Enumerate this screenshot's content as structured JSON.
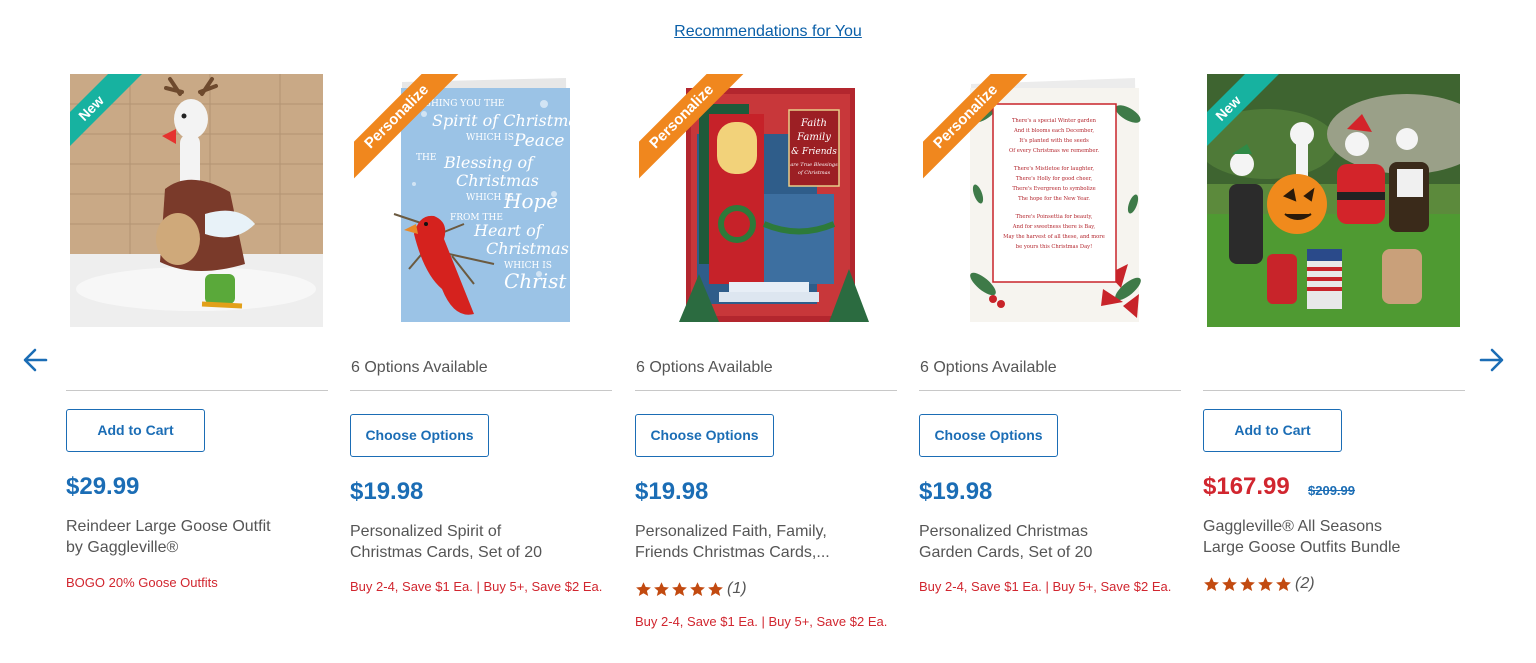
{
  "section": {
    "title": "Recommendations for You"
  },
  "nav": {
    "prev_icon": "arrow-left-icon",
    "next_icon": "arrow-right-icon"
  },
  "colors": {
    "link": "#1b6db5",
    "sale": "#d1262f",
    "new_badge": "#17b2a0",
    "personalize_badge": "#f0871e",
    "star": "#c24a10"
  },
  "products": [
    {
      "badge": "New",
      "options_text": "",
      "button_label": "Add to Cart",
      "price": "$29.99",
      "name": "Reindeer Large Goose Outfit by Gaggleville®",
      "promo": "BOGO 20% Goose Outfits"
    },
    {
      "badge": "Personalize",
      "options_text": "6 Options Available",
      "button_label": "Choose Options",
      "price": "$19.98",
      "name": "Personalized Spirit of Christmas Cards, Set of 20",
      "promo": "Buy 2-4, Save $1 Ea. | Buy 5+, Save $2 Ea.",
      "card_text": {
        "l1": "WISHING YOU THE",
        "l2": "Spirit of Christmas",
        "l3": "WHICH IS",
        "l4": "Peace",
        "l5": "THE",
        "l6": "Blessing of",
        "l7": "Christmas",
        "l8": "WHICH IS",
        "l9": "Hope",
        "l10": "FROM THE",
        "l11": "Heart of",
        "l12": "Christmas",
        "l13": "WHICH IS",
        "l14": "Christ"
      }
    },
    {
      "badge": "Personalize",
      "options_text": "6 Options Available",
      "button_label": "Choose Options",
      "price": "$19.98",
      "name": "Personalized Faith, Family, Friends Christmas Cards,...",
      "rating_value": 5,
      "rating_count": "(1)",
      "promo": "Buy 2-4, Save $1 Ea. | Buy 5+, Save $2 Ea.",
      "card_text": {
        "l1": "Faith",
        "l2": "Family",
        "l3": "& Friends",
        "l4": "are True Blessings",
        "l5": "of Christmas"
      }
    },
    {
      "badge": "Personalize",
      "options_text": "6 Options Available",
      "button_label": "Choose Options",
      "price": "$19.98",
      "name": "Personalized Christmas Garden Cards, Set of 20",
      "promo": "Buy 2-4, Save $1 Ea. | Buy 5+, Save $2 Ea.",
      "card_text": {
        "l1": "There's a special Winter garden",
        "l2": "And it blooms each December,",
        "l3": "It's planted with the seeds",
        "l4": "Of every Christmas we remember.",
        "l5": "There's Mistletoe for laughter,",
        "l6": "There's Holly for good cheer,",
        "l7": "There's Evergreen to symbolize",
        "l8": "The hope for the New Year.",
        "l9": "There's Poinsettia for beauty,",
        "l10": "And for sweetness there is Bay,",
        "l11": "May the harvest of all these, and more",
        "l12": "be yours this Christmas Day!"
      }
    },
    {
      "badge": "New",
      "options_text": "",
      "button_label": "Add to Cart",
      "price": "$167.99",
      "old_price": "$209.99",
      "name": "Gaggleville® All Seasons Large Goose Outfits Bundle",
      "rating_value": 5,
      "rating_count": "(2)"
    }
  ]
}
